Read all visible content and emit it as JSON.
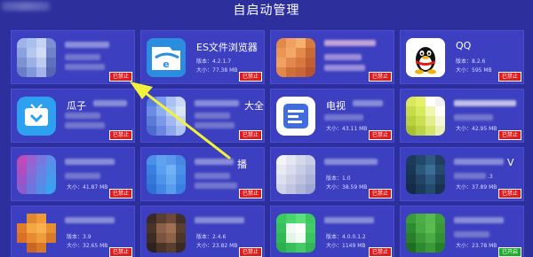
{
  "header": {
    "title": "自启动管理"
  },
  "labels": {
    "version_prefix": "版本：",
    "size_prefix": "大小："
  },
  "cards": [
    {
      "name": "",
      "version": "",
      "size": "",
      "status": "已禁止"
    },
    {
      "name": "ES文件浏览器",
      "version": "4.2.1.7",
      "size": "77.38 MB",
      "status": "已禁止"
    },
    {
      "name": "",
      "version": "",
      "size": "",
      "status": "已禁止"
    },
    {
      "name": "QQ",
      "version": "8.2.6",
      "size": "595 MB",
      "status": "已禁止"
    },
    {
      "name": "瓜子",
      "version": "",
      "size": "",
      "status": "已禁止"
    },
    {
      "name": "大全",
      "version": "",
      "size": "",
      "status": "已禁止"
    },
    {
      "name": "电视",
      "version": "",
      "size": "43.11 MB",
      "status": "已禁止"
    },
    {
      "name": "",
      "version": "",
      "size": "42.95 MB",
      "status": "已禁止"
    },
    {
      "name": "",
      "version": "",
      "size": "41.87 MB",
      "status": "已禁止"
    },
    {
      "name": "播",
      "version": "",
      "size": "",
      "status": "已禁止"
    },
    {
      "name": "",
      "version": "1.0",
      "size": "38.59 MB",
      "status": "已禁止"
    },
    {
      "name": "V",
      "version": ".3",
      "size": "37.89 MB",
      "status": "已禁止"
    },
    {
      "name": "",
      "version": "3.9",
      "size": "32.65 MB",
      "status": "已禁止"
    },
    {
      "name": "",
      "version": "2.4.6",
      "size": "23.82 MB",
      "status": "已禁止"
    },
    {
      "name": "",
      "version": "4.0.0.1.2",
      "size": "1149 MB",
      "status": "已禁止"
    },
    {
      "name": "",
      "version": "",
      "size": "23.78 MB",
      "status": "已开启"
    }
  ]
}
